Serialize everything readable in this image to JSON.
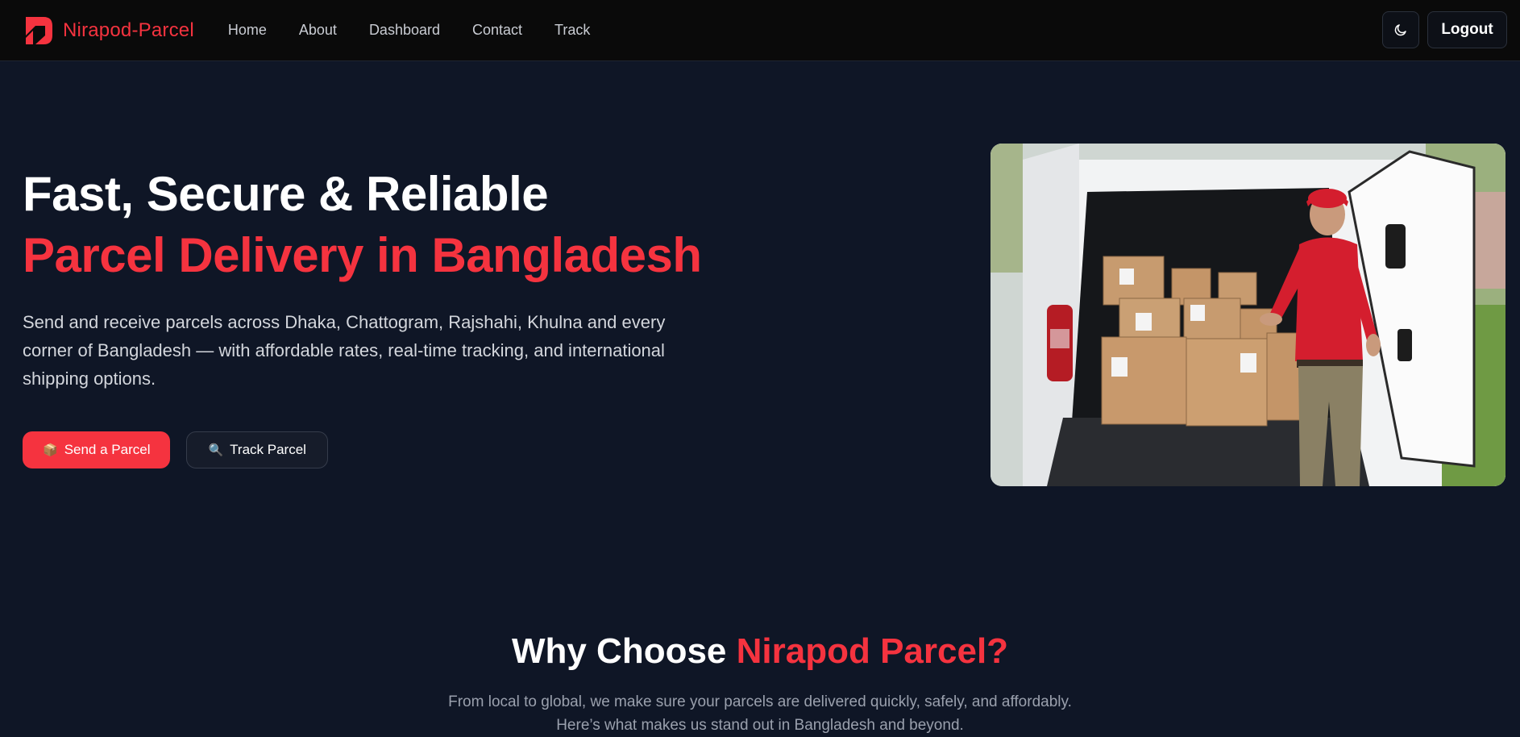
{
  "navbar": {
    "brand": "Nirapod-Parcel",
    "links": [
      "Home",
      "About",
      "Dashboard",
      "Contact",
      "Track"
    ],
    "theme_toggle_icon": "moon-icon",
    "logout_label": "Logout"
  },
  "hero": {
    "title_line1": "Fast, Secure & Reliable",
    "title_line2": "Parcel Delivery in Bangladesh",
    "description": "Send and receive parcels across Dhaka, Chattogram, Rajshahi, Khulna and every corner of Bangladesh — with affordable rates, real-time tracking, and international shipping options.",
    "primary_button": {
      "icon": "📦",
      "label": "Send a Parcel"
    },
    "secondary_button": {
      "icon": "🔍",
      "label": "Track Parcel"
    },
    "image_icon": "delivery-man-van-photo"
  },
  "why": {
    "title_prefix": "Why Choose",
    "title_accent": "Nirapod Parcel?",
    "subtitle_line1": "From local to global, we make sure your parcels are delivered quickly, safely, and affordably.",
    "subtitle_line2": "Here’s what makes us stand out in Bangladesh and beyond."
  },
  "colors": {
    "accent": "#f5333f",
    "background": "#0f1626",
    "navbar_bg": "#0a0a0a"
  }
}
